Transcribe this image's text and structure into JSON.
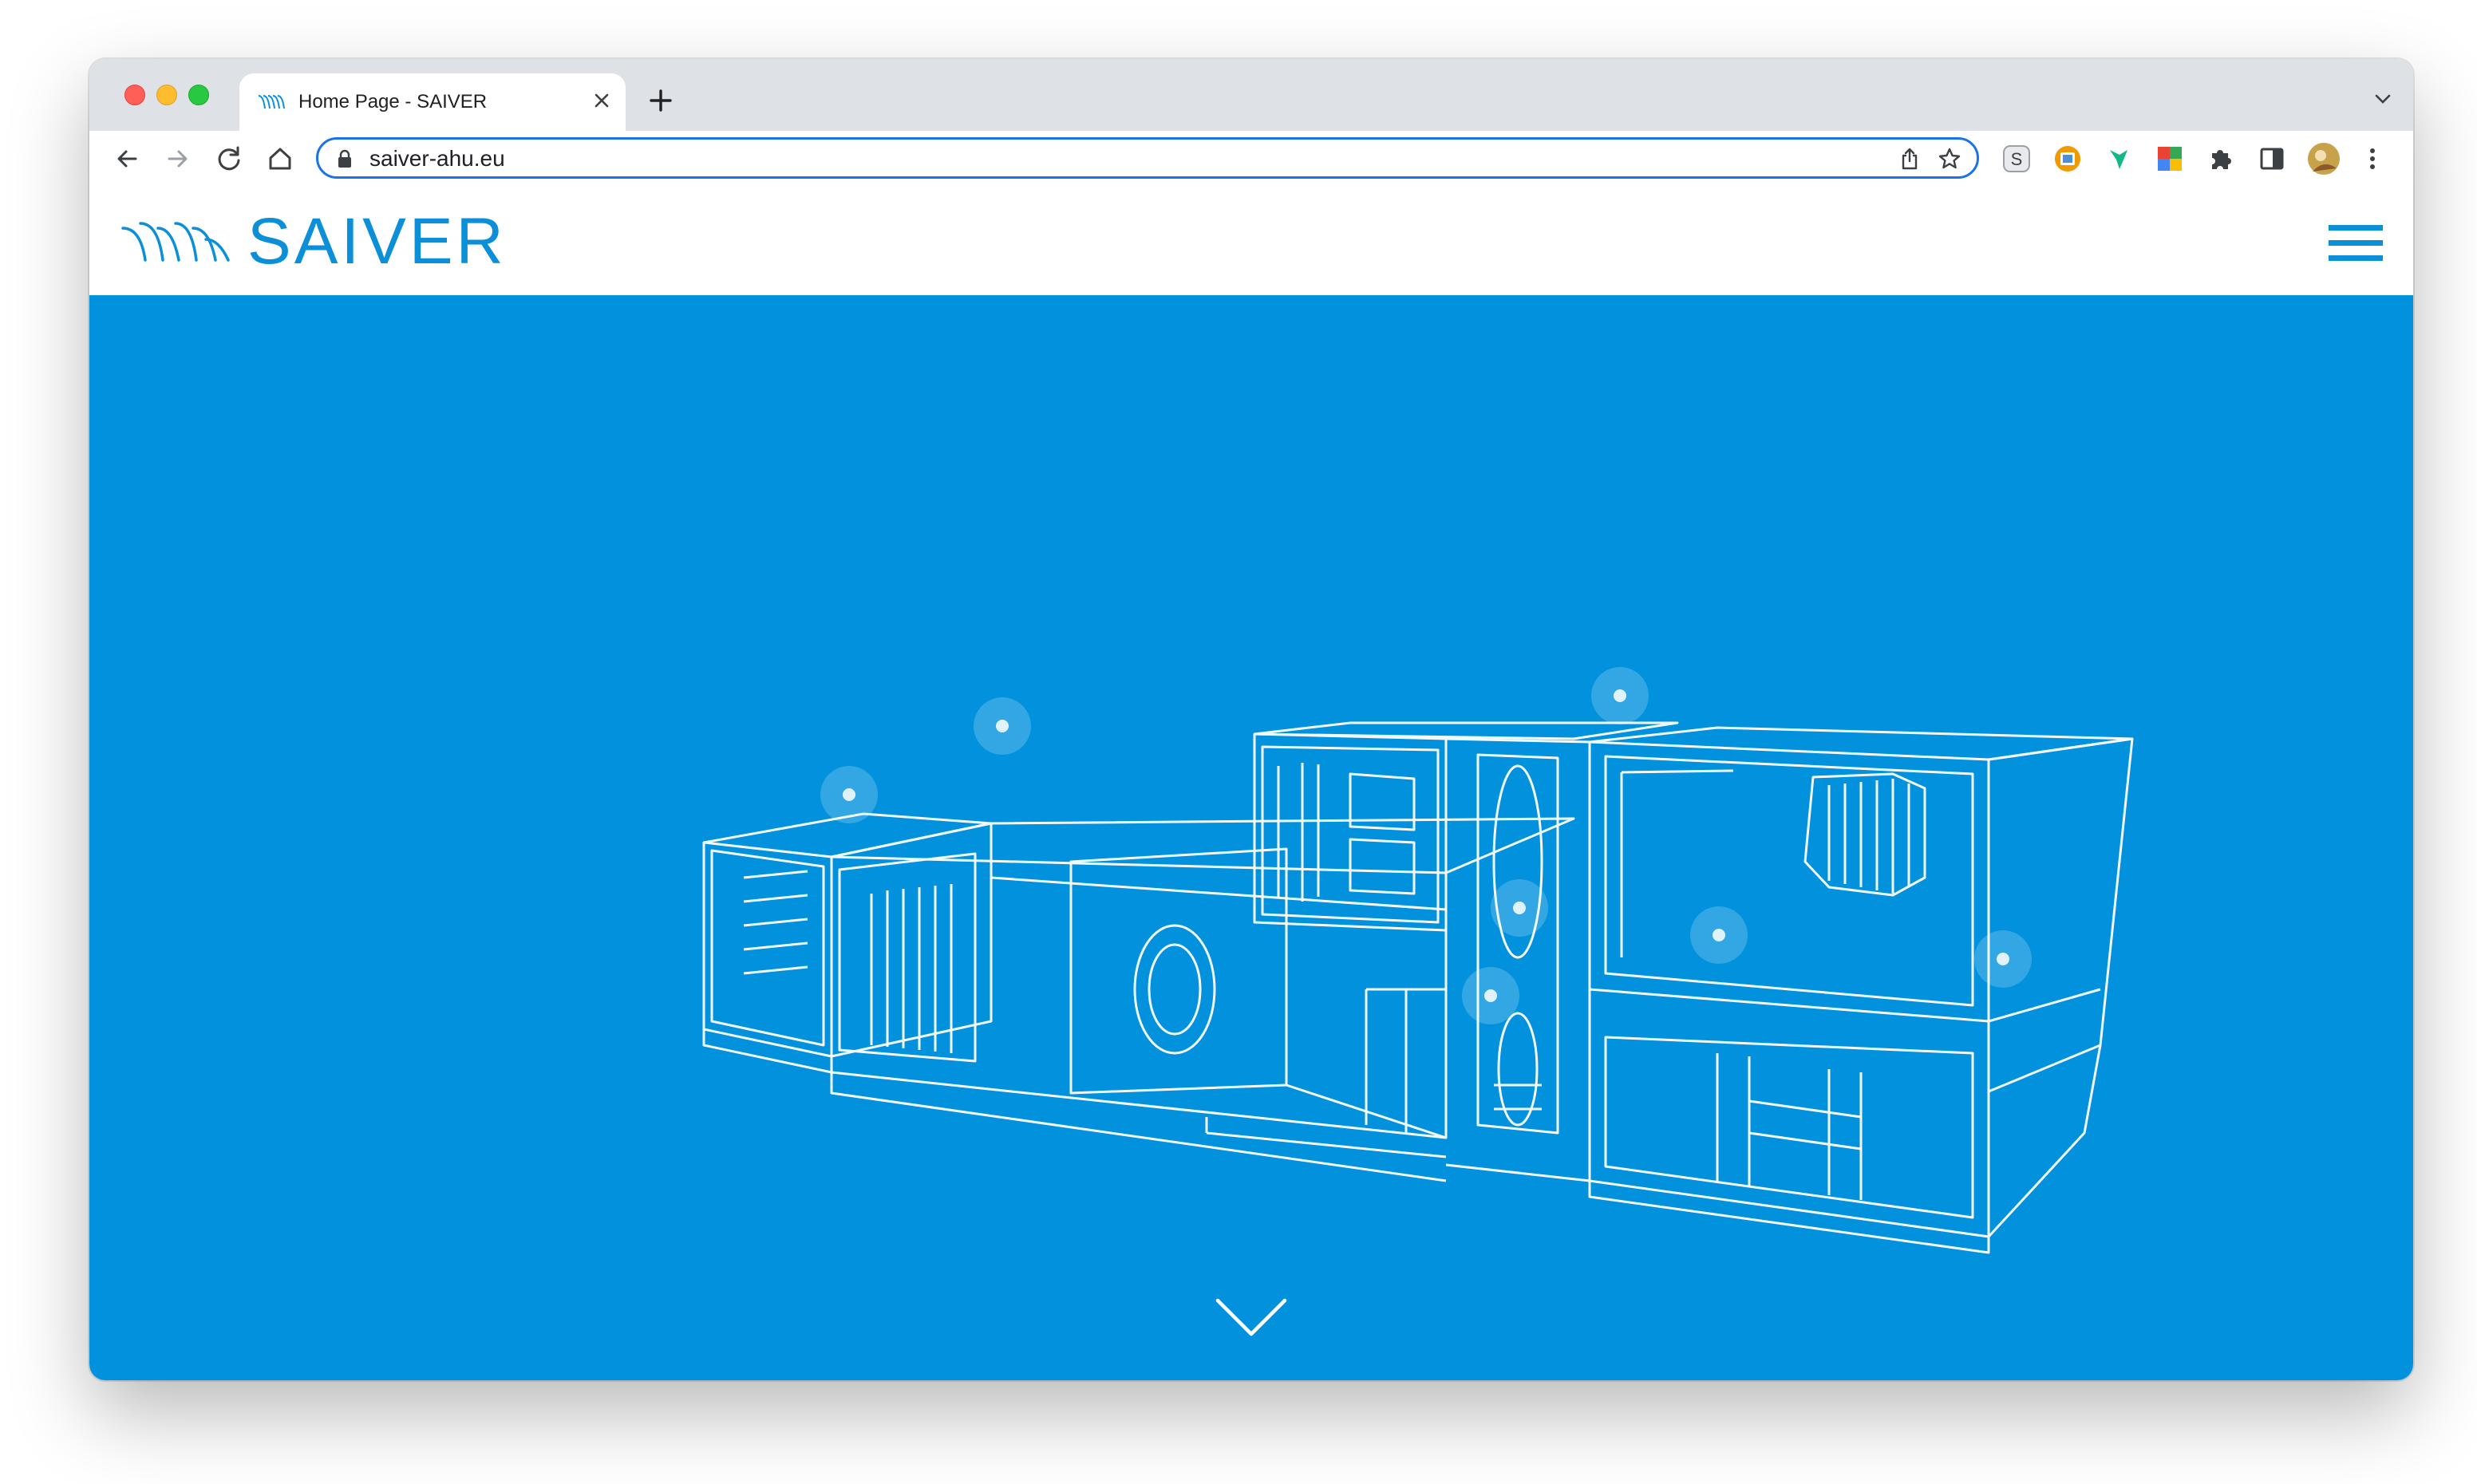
{
  "browser": {
    "tab": {
      "title": "Home Page - SAIVER"
    },
    "address_bar": {
      "url": "saiver-ahu.eu"
    },
    "extensions": [
      "s-extension-icon",
      "photo-extension-icon",
      "bird-extension-icon",
      "palette-extension-icon",
      "puzzle-icon",
      "sidebar-icon",
      "profile-avatar"
    ]
  },
  "site": {
    "logo_text": "SAIVER",
    "brand_color": "#0a8fd8",
    "hero_color": "#0191dd",
    "menu_icon": "hamburger-menu-icon",
    "scroll_icon": "chevron-down-icon"
  }
}
